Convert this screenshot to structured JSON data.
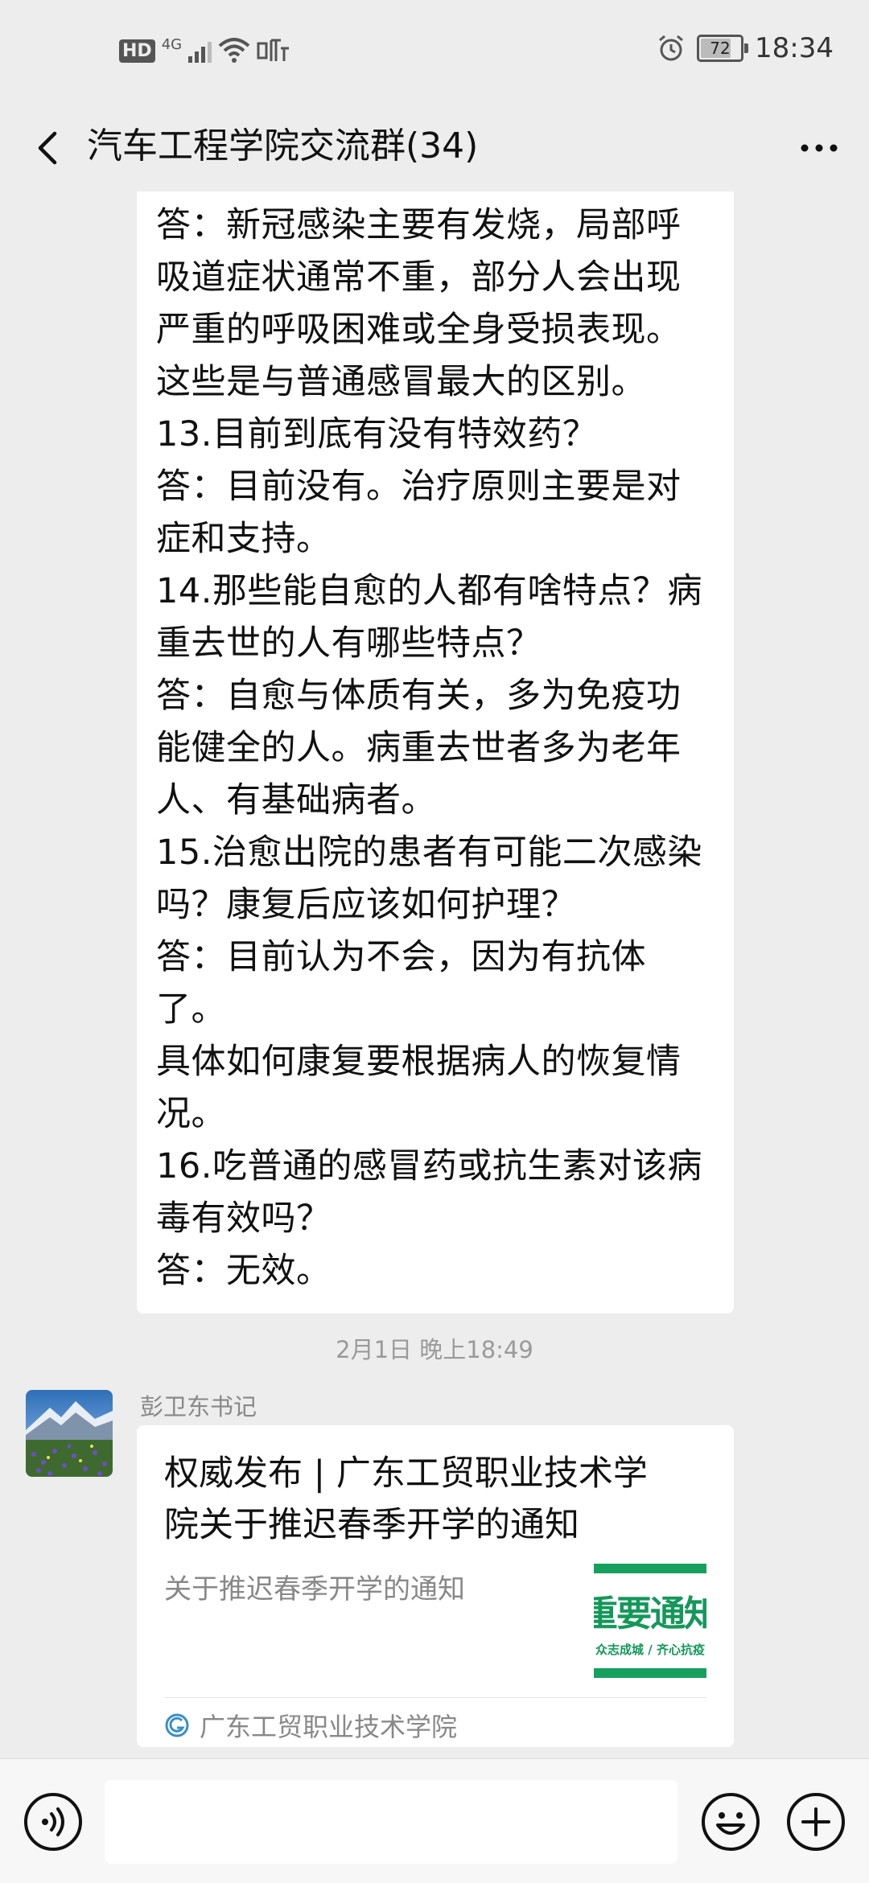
{
  "status_bar": {
    "hd": "HD",
    "network": "4G",
    "battery": "72",
    "battery_level": 0.72,
    "time": "18:34",
    "icons": [
      "signal-icon",
      "wifi-icon",
      "listen-icon",
      "alarm-icon",
      "battery-icon"
    ]
  },
  "nav": {
    "title": "汽车工程学院交流群(34)",
    "icons": [
      "back-icon",
      "more-icon"
    ]
  },
  "messages": {
    "qa_lines": [
      "答：新冠感染主要有发烧，局部呼",
      "吸道症状通常不重，部分人会出现",
      "严重的呼吸困难或全身受损表现。",
      "这些是与普通感冒最大的区别。",
      "13.目前到底有没有特效药？",
      "答：目前没有。治疗原则主要是对",
      "症和支持。",
      "14.那些能自愈的人都有啥特点？病",
      "重去世的人有哪些特点？",
      "答：自愈与体质有关，多为免疫功",
      "能健全的人。病重去世者多为老年",
      "人、有基础病者。",
      "15.治愈出院的患者有可能二次感染",
      "吗？康复后应该如何护理？",
      "答：目前认为不会，因为有抗体了。",
      "具体如何康复要根据病人的恢复情",
      "况。",
      "16.吃普通的感冒药或抗生素对该病",
      "毒有效吗？",
      "答：无效。"
    ],
    "timestamp": "2月1日 晚上18:49",
    "sender": "彭卫东书记",
    "card": {
      "title": "权威发布 | 广东工贸职业技术学院关于推迟春季开学的通知",
      "description": "关于推迟春季开学的通知",
      "thumb_main": "重要通知",
      "thumb_sub": "众志成城 / 齐心抗疫",
      "source": "广东工贸职业技术学院",
      "accent": "#16a05d"
    }
  },
  "input_bar": {
    "icons": [
      "voice-icon",
      "emoji-icon",
      "plus-icon"
    ]
  }
}
